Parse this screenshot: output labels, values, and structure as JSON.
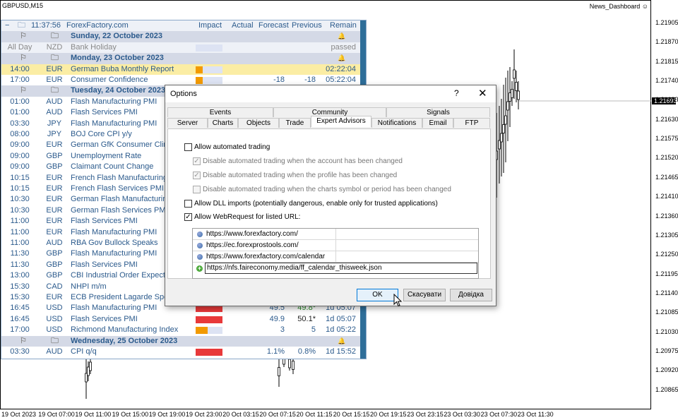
{
  "chart": {
    "symbol": "GBPUSD,M15",
    "indicator": "News_Dashboard",
    "current_price": "1.21693",
    "price_ticks": [
      "1.21905",
      "1.21870",
      "1.21815",
      "1.21740",
      "1.21693",
      "1.21630",
      "1.21575",
      "1.21520",
      "1.21465",
      "1.21410",
      "1.21360",
      "1.21305",
      "1.21250",
      "1.21195",
      "1.21140",
      "1.21085",
      "1.21030",
      "1.20975",
      "1.20920",
      "1.20865"
    ],
    "time_ticks": [
      "19 Oct 2023",
      "19 Oct 07:00",
      "19 Oct 11:00",
      "19 Oct 15:00",
      "19 Oct 19:00",
      "19 Oct 23:00",
      "20 Oct 03:15",
      "20 Oct 07:15",
      "20 Oct 11:15",
      "20 Oct 15:15",
      "20 Oct 19:15",
      "23 Oct 23:15",
      "23 Oct 03:30",
      "23 Oct 07:30",
      "23 Oct 11:30"
    ]
  },
  "news": {
    "header": {
      "time": "11:37:56",
      "source": "ForexFactory.com",
      "impact": "Impact",
      "actual": "Actual",
      "forecast": "Forecast",
      "previous": "Previous",
      "remain": "Remain",
      "collapse": "−"
    },
    "rows": [
      {
        "kind": "day",
        "label": "Sunday, 22 October 2023"
      },
      {
        "kind": "event",
        "time": "All Day",
        "cur": "NZD",
        "event": "Bank Holiday",
        "impact": 0,
        "impact_color": "#dde3f3",
        "actual": "",
        "forecast": "",
        "previous": "",
        "remain": "passed",
        "style": "grey"
      },
      {
        "kind": "day",
        "label": "Monday, 23 October 2023"
      },
      {
        "kind": "event",
        "time": "14:00",
        "cur": "EUR",
        "event": "German Buba Monthly Report",
        "impact": 0.25,
        "impact_color": "#f29a00",
        "actual": "",
        "forecast": "",
        "previous": "",
        "remain": "02:22:04",
        "style": "hl"
      },
      {
        "kind": "event",
        "time": "17:00",
        "cur": "EUR",
        "event": "Consumer Confidence",
        "impact": 0.25,
        "impact_color": "#f29a00",
        "actual": "",
        "forecast": "-18",
        "previous": "-18",
        "remain": "05:22:04",
        "style": ""
      },
      {
        "kind": "day",
        "label": "Tuesday, 24 October 2023"
      },
      {
        "kind": "event",
        "time": "01:00",
        "cur": "AUD",
        "event": "Flash Manufacturing PMI",
        "impact": 0,
        "actual": "",
        "forecast": "",
        "previous": "",
        "remain": "",
        "style": ""
      },
      {
        "kind": "event",
        "time": "01:00",
        "cur": "AUD",
        "event": "Flash Services PMI",
        "impact": 0,
        "actual": "",
        "forecast": "",
        "previous": "",
        "remain": "",
        "style": ""
      },
      {
        "kind": "event",
        "time": "03:30",
        "cur": "JPY",
        "event": "Flash Manufacturing PMI",
        "impact": 0,
        "actual": "",
        "forecast": "",
        "previous": "",
        "remain": "",
        "style": ""
      },
      {
        "kind": "event",
        "time": "08:00",
        "cur": "JPY",
        "event": "BOJ Core CPI y/y",
        "impact": 0,
        "actual": "",
        "forecast": "",
        "previous": "",
        "remain": "",
        "style": ""
      },
      {
        "kind": "event",
        "time": "09:00",
        "cur": "EUR",
        "event": "German GfK Consumer Climate",
        "impact": 0,
        "actual": "",
        "forecast": "",
        "previous": "",
        "remain": "",
        "style": ""
      },
      {
        "kind": "event",
        "time": "09:00",
        "cur": "GBP",
        "event": "Unemployment Rate",
        "impact": 0,
        "actual": "",
        "forecast": "",
        "previous": "",
        "remain": "",
        "style": ""
      },
      {
        "kind": "event",
        "time": "09:00",
        "cur": "GBP",
        "event": "Claimant Count Change",
        "impact": 0,
        "actual": "",
        "forecast": "",
        "previous": "",
        "remain": "",
        "style": ""
      },
      {
        "kind": "event",
        "time": "10:15",
        "cur": "EUR",
        "event": "French Flash Manufacturing PM",
        "impact": 0,
        "actual": "",
        "forecast": "",
        "previous": "",
        "remain": "",
        "style": ""
      },
      {
        "kind": "event",
        "time": "10:15",
        "cur": "EUR",
        "event": "French Flash Services PMI",
        "impact": 0,
        "actual": "",
        "forecast": "",
        "previous": "",
        "remain": "",
        "style": ""
      },
      {
        "kind": "event",
        "time": "10:30",
        "cur": "EUR",
        "event": "German Flash Manufacturing PM",
        "impact": 0,
        "actual": "",
        "forecast": "",
        "previous": "",
        "remain": "",
        "style": ""
      },
      {
        "kind": "event",
        "time": "10:30",
        "cur": "EUR",
        "event": "German Flash Services PMI",
        "impact": 0,
        "actual": "",
        "forecast": "",
        "previous": "",
        "remain": "",
        "style": ""
      },
      {
        "kind": "event",
        "time": "11:00",
        "cur": "EUR",
        "event": "Flash Services PMI",
        "impact": 0,
        "actual": "",
        "forecast": "",
        "previous": "",
        "remain": "",
        "style": ""
      },
      {
        "kind": "event",
        "time": "11:00",
        "cur": "EUR",
        "event": "Flash Manufacturing PMI",
        "impact": 0,
        "actual": "",
        "forecast": "",
        "previous": "",
        "remain": "",
        "style": ""
      },
      {
        "kind": "event",
        "time": "11:00",
        "cur": "AUD",
        "event": "RBA Gov Bullock Speaks",
        "impact": 0,
        "actual": "",
        "forecast": "",
        "previous": "",
        "remain": "",
        "style": ""
      },
      {
        "kind": "event",
        "time": "11:30",
        "cur": "GBP",
        "event": "Flash Manufacturing PMI",
        "impact": 0,
        "actual": "",
        "forecast": "",
        "previous": "",
        "remain": "",
        "style": ""
      },
      {
        "kind": "event",
        "time": "11:30",
        "cur": "GBP",
        "event": "Flash Services PMI",
        "impact": 0,
        "actual": "",
        "forecast": "",
        "previous": "",
        "remain": "",
        "style": ""
      },
      {
        "kind": "event",
        "time": "13:00",
        "cur": "GBP",
        "event": "CBI Industrial Order Expectati",
        "impact": 0,
        "actual": "",
        "forecast": "",
        "previous": "",
        "remain": "",
        "style": ""
      },
      {
        "kind": "event",
        "time": "15:30",
        "cur": "CAD",
        "event": "NHPI m/m",
        "impact": 0,
        "actual": "",
        "forecast": "",
        "previous": "",
        "remain": "",
        "style": ""
      },
      {
        "kind": "event",
        "time": "15:30",
        "cur": "EUR",
        "event": "ECB President Lagarde Speaks",
        "impact": 0,
        "actual": "",
        "forecast": "",
        "previous": "",
        "remain": "",
        "style": ""
      },
      {
        "kind": "event",
        "time": "16:45",
        "cur": "USD",
        "event": "Flash Manufacturing PMI",
        "impact": 1,
        "impact_color": "#e8393a",
        "actual": "",
        "forecast": "49.5",
        "previous": "49.8*",
        "remain": "1d 05:07",
        "style": "",
        "prev_color": "green"
      },
      {
        "kind": "event",
        "time": "16:45",
        "cur": "USD",
        "event": "Flash Services PMI",
        "impact": 1,
        "impact_color": "#e8393a",
        "actual": "",
        "forecast": "49.9",
        "previous": "50.1*",
        "remain": "1d 05:07",
        "style": "",
        "prev_color": "dark"
      },
      {
        "kind": "event",
        "time": "17:00",
        "cur": "USD",
        "event": "Richmond Manufacturing Index",
        "impact": 0.45,
        "impact_color": "#f29a00",
        "actual": "",
        "forecast": "3",
        "previous": "5",
        "remain": "1d 05:22",
        "style": ""
      },
      {
        "kind": "day",
        "label": "Wednesday, 25 October 2023"
      },
      {
        "kind": "event",
        "time": "03:30",
        "cur": "AUD",
        "event": "CPI q/q",
        "impact": 1,
        "impact_color": "#e8393a",
        "actual": "",
        "forecast": "1.1%",
        "previous": "0.8%",
        "remain": "1d 15:52",
        "style": ""
      }
    ]
  },
  "dialog": {
    "title": "Options",
    "help": "?",
    "close": "✕",
    "tabs_top": [
      "Events",
      "Community",
      "Signals"
    ],
    "tabs_bottom": [
      "Server",
      "Charts",
      "Objects",
      "Trade",
      "Expert Advisors",
      "Notifications",
      "Email",
      "FTP"
    ],
    "active_tab": "Expert Advisors",
    "options": [
      {
        "label": "Allow automated trading",
        "checked": false,
        "disabled": false
      },
      {
        "label": "Disable automated trading when the account has been changed",
        "checked": true,
        "disabled": true
      },
      {
        "label": "Disable automated trading when the profile has been changed",
        "checked": true,
        "disabled": true
      },
      {
        "label": "Disable automated trading when the charts symbol or period has been changed",
        "checked": false,
        "disabled": true
      },
      {
        "label": "Allow DLL imports (potentially dangerous, enable only for trusted applications)",
        "checked": false,
        "disabled": false
      },
      {
        "label": "Allow WebRequest for listed URL:",
        "checked": true,
        "disabled": false
      }
    ],
    "urls": [
      "https://www.forexfactory.com/",
      "https://ec.forexprostools.com/",
      "https://www.forexfactory.com/calendar"
    ],
    "url_edit": "https://nfs.faireconomy.media/ff_calendar_thisweek.json",
    "buttons": {
      "ok": "OK",
      "cancel": "Скасувати",
      "help": "Довідка"
    }
  }
}
